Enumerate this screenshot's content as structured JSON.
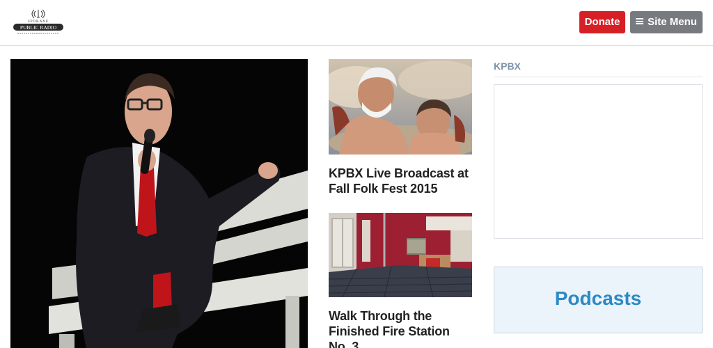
{
  "header": {
    "logo_top": "SPOKANE",
    "logo_main": "PUBLIC RADIO",
    "donate_label": "Donate",
    "menu_label": "Site Menu"
  },
  "stories": [
    {
      "title": "KPBX Live Broadcast at Fall Folk Fest 2015"
    },
    {
      "title": "Walk Through the Finished Fire Station No. 3"
    }
  ],
  "sidebar": {
    "heading": "KPBX",
    "podcasts_label": "Podcasts"
  },
  "colors": {
    "donate": "#d71f26",
    "menu": "#777b80",
    "accent": "#2a8ac4"
  }
}
